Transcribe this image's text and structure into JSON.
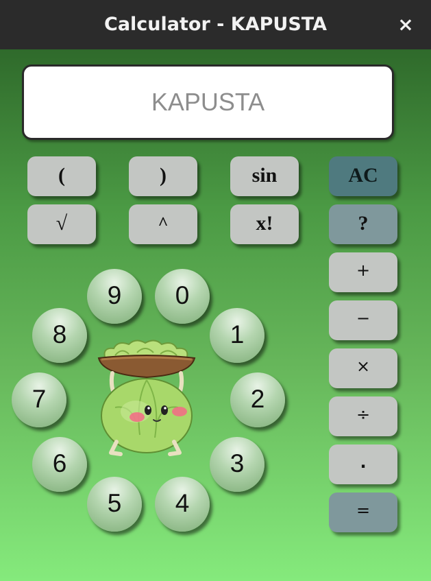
{
  "window": {
    "title": "Calculator - KAPUSTA",
    "close_symbol": "×"
  },
  "display": {
    "value": "KAPUSTA"
  },
  "function_keys": {
    "open_paren": "(",
    "close_paren": ")",
    "sin": "sin",
    "sqrt": "√",
    "power": "^",
    "factorial": "x!"
  },
  "side_keys": {
    "clear": "AC",
    "help": "?",
    "plus": "+",
    "minus": "−",
    "times": "×",
    "divide": "÷",
    "decimal": ".",
    "equals": "="
  },
  "digits": {
    "d0": "0",
    "d1": "1",
    "d2": "2",
    "d3": "3",
    "d4": "4",
    "d5": "5",
    "d6": "6",
    "d7": "7",
    "d8": "8",
    "d9": "9"
  },
  "colors": {
    "titlebar": "#2b2b2b",
    "background_top": "#2f6a2b",
    "background_bottom": "#85ea7c",
    "key_grey": "#c3c6c3",
    "key_slate_dark": "#4f7a7f",
    "key_slate_light": "#7f989c"
  },
  "mascot": {
    "icon": "cabbage-mascot-icon"
  }
}
